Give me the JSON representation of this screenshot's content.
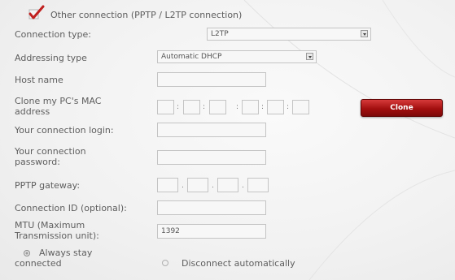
{
  "connection_option": {
    "label": "Other connection (PPTP / L2TP connection)",
    "checked": true
  },
  "fields": {
    "connection_type": {
      "label": "Connection type:",
      "value": "L2TP"
    },
    "addressing_type": {
      "label": "Addressing type",
      "value": "Automatic DHCP"
    },
    "host_name": {
      "label": "Host name",
      "value": ""
    },
    "clone_mac": {
      "label_line1": "Clone my PC's MAC",
      "label_line2": "address",
      "octets": [
        "",
        "",
        "",
        "",
        "",
        ""
      ],
      "separator": ":",
      "button_label": "Clone"
    },
    "login": {
      "label": "Your connection login:",
      "value": ""
    },
    "password": {
      "label_line1": "Your connection",
      "label_line2": "password:",
      "value": ""
    },
    "pptp_gateway": {
      "label": "PPTP gateway:",
      "octets": [
        "",
        "",
        "",
        ""
      ],
      "separator": "."
    },
    "connection_id": {
      "label": "Connection ID (optional):",
      "value": ""
    },
    "mtu": {
      "label_line1": "MTU (Maximum",
      "label_line2": "Transmission unit):",
      "value": "1392"
    }
  },
  "connection_mode": {
    "always_stay": {
      "label_line1": "Always stay",
      "label_line2": "connected",
      "selected": true
    },
    "disconnect_auto": {
      "label": "Disconnect automatically",
      "selected": false
    }
  },
  "colors": {
    "checkmark": "#c0201f",
    "clone_button": "#a30f0f",
    "label_text": "#5e5e5e"
  }
}
